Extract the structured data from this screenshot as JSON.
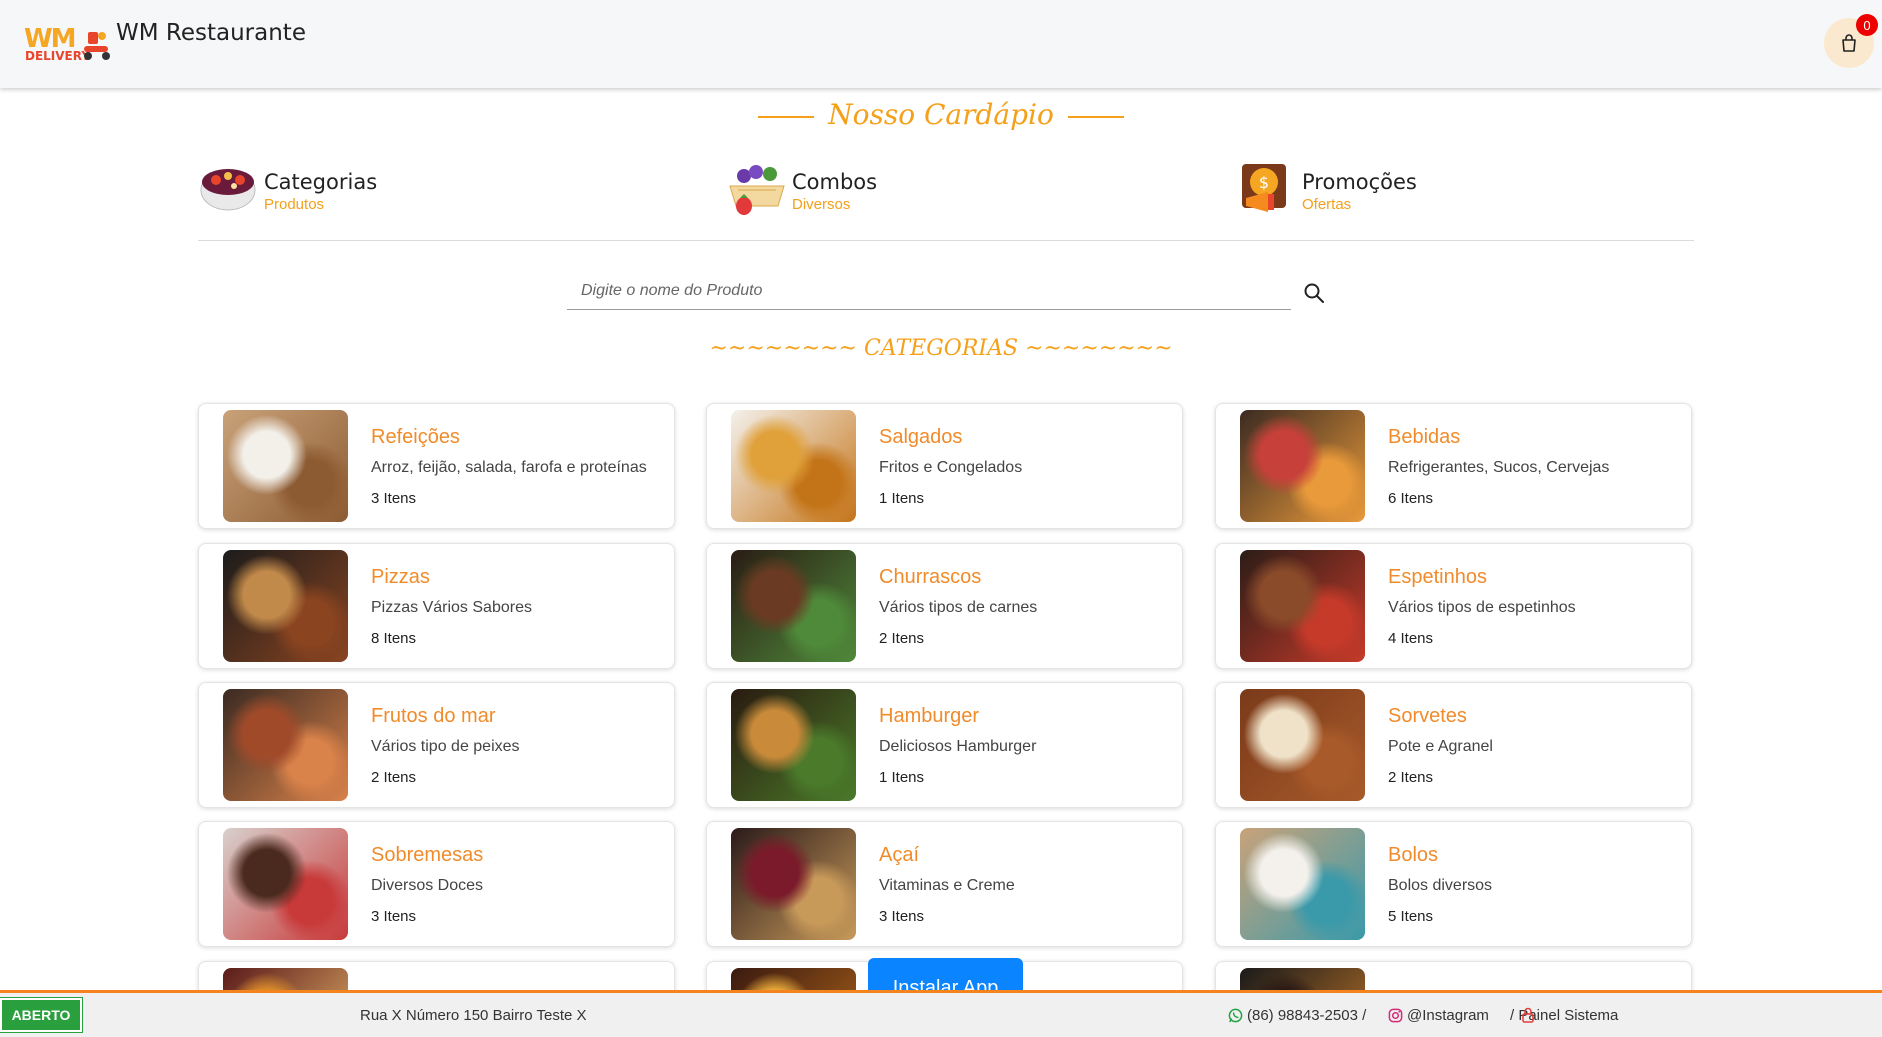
{
  "header": {
    "logo_line1": "WM",
    "logo_line2": "DELIVERY",
    "site_title": "WM Restaurante",
    "cart_count": "0"
  },
  "menu": {
    "title": "Nosso Cardápio",
    "tabs": [
      {
        "title": "Categorias",
        "subtitle": "Produtos",
        "icon": "acai-bowl-icon"
      },
      {
        "title": "Combos",
        "subtitle": "Diversos",
        "icon": "fruit-basket-icon"
      },
      {
        "title": "Promoções",
        "subtitle": "Ofertas",
        "icon": "money-megaphone-icon"
      }
    ]
  },
  "search": {
    "placeholder": "Digite o nome do Produto"
  },
  "categories_heading": "~~~~~~~~ CATEGORIAS ~~~~~~~~",
  "categories": [
    {
      "title": "Refeições",
      "desc": "Arroz, feijão, salada, farofa e proteínas",
      "count": "3 Itens",
      "colors": [
        "#c9a27a",
        "#f3f0ea",
        "#8d5b32"
      ]
    },
    {
      "title": "Salgados",
      "desc": "Fritos e Congelados",
      "count": "1 Itens",
      "colors": [
        "#f4f1ec",
        "#e0a13a",
        "#c47418"
      ]
    },
    {
      "title": "Bebidas",
      "desc": "Refrigerantes, Sucos, Cervejas",
      "count": "6 Itens",
      "colors": [
        "#3b2a22",
        "#c8403a",
        "#e99a3a"
      ]
    },
    {
      "title": "Pizzas",
      "desc": "Pizzas Vários Sabores",
      "count": "8 Itens",
      "colors": [
        "#1c1c1c",
        "#c28a4a",
        "#8a4420"
      ]
    },
    {
      "title": "Churrascos",
      "desc": "Vários tipos de carnes",
      "count": "2 Itens",
      "colors": [
        "#2a1c14",
        "#6b3a22",
        "#4f8a3a"
      ]
    },
    {
      "title": "Espetinhos",
      "desc": "Vários tipos de espetinhos",
      "count": "4 Itens",
      "colors": [
        "#2b1d17",
        "#8a4b2a",
        "#c63a2a"
      ]
    },
    {
      "title": "Frutos do mar",
      "desc": "Vários tipo de peixes",
      "count": "2 Itens",
      "colors": [
        "#3a2a22",
        "#a04a2a",
        "#d9824a"
      ]
    },
    {
      "title": "Hamburger",
      "desc": "Deliciosos Hamburger",
      "count": "1 Itens",
      "colors": [
        "#2a1a10",
        "#c98a3a",
        "#4a7a2a"
      ]
    },
    {
      "title": "Sorvetes",
      "desc": "Pote e Agranel",
      "count": "2 Itens",
      "colors": [
        "#7a3a1a",
        "#efe2c8",
        "#a85a2a"
      ]
    },
    {
      "title": "Sobremesas",
      "desc": "Diversos Doces",
      "count": "3 Itens",
      "colors": [
        "#d8d0cc",
        "#4a2a1e",
        "#c83a3a"
      ]
    },
    {
      "title": "Açaí",
      "desc": "Vitaminas e Creme",
      "count": "3 Itens",
      "colors": [
        "#2a1a1a",
        "#7a1a2a",
        "#c89a5a"
      ]
    },
    {
      "title": "Bolos",
      "desc": "Bolos diversos",
      "count": "5 Itens",
      "colors": [
        "#c9a27a",
        "#f4f1ec",
        "#3a9aaa"
      ]
    },
    {
      "title": "",
      "desc": "",
      "count": "",
      "colors": [
        "#5a1a1a",
        "#d98a2a",
        "#f0c070"
      ]
    },
    {
      "title": "",
      "desc": "",
      "count": "",
      "colors": [
        "#3a1a10",
        "#e8a83a",
        "#b86a1a"
      ]
    },
    {
      "title": "",
      "desc": "",
      "count": "",
      "colors": [
        "#1a1a1a",
        "#2a1a14",
        "#c87a2a"
      ]
    }
  ],
  "footer": {
    "status": "ABERTO",
    "address": "Rua X Número 150 Bairro Teste X",
    "phone": "(86) 98843-2503 /",
    "instagram": "@Instagram",
    "panel": "/ Painel Sistema"
  },
  "install_button": "Instalar App",
  "colors": {
    "accent": "#f5a01a",
    "card_title": "#f18b2a",
    "footer_border": "#f5841f",
    "open_status": "#2a9f3e",
    "install_button": "#0a84ff",
    "cart_badge": "#ee0000"
  }
}
